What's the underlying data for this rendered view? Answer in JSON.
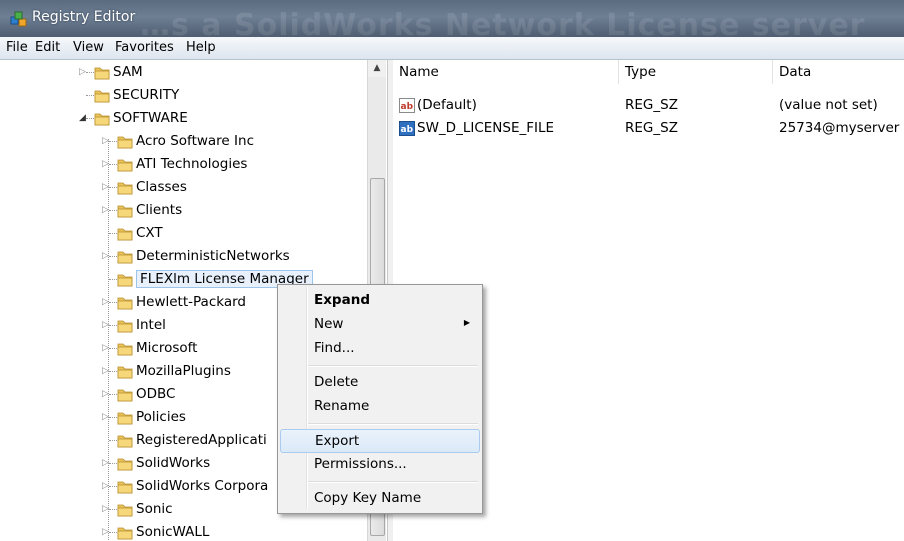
{
  "window": {
    "title": "Registry Editor",
    "background_title": "…s a SolidWorks Network License server"
  },
  "menubar": [
    "File",
    "Edit",
    "View",
    "Favorites",
    "Help"
  ],
  "tree": {
    "rows": [
      {
        "label": "SAM",
        "level": 0,
        "expander": "collapsed"
      },
      {
        "label": "SECURITY",
        "level": 0,
        "expander": "none"
      },
      {
        "label": "SOFTWARE",
        "level": 0,
        "expander": "expanded"
      },
      {
        "label": "Acro Software Inc",
        "level": 1,
        "expander": "collapsed"
      },
      {
        "label": "ATI Technologies",
        "level": 1,
        "expander": "collapsed"
      },
      {
        "label": "Classes",
        "level": 1,
        "expander": "collapsed"
      },
      {
        "label": "Clients",
        "level": 1,
        "expander": "collapsed"
      },
      {
        "label": "CXT",
        "level": 1,
        "expander": "none"
      },
      {
        "label": "DeterministicNetworks",
        "level": 1,
        "expander": "collapsed"
      },
      {
        "label": "FLEXlm License Manager",
        "level": 1,
        "expander": "none",
        "selected": true
      },
      {
        "label": "Hewlett-Packard",
        "level": 1,
        "expander": "collapsed"
      },
      {
        "label": "Intel",
        "level": 1,
        "expander": "collapsed"
      },
      {
        "label": "Microsoft",
        "level": 1,
        "expander": "collapsed"
      },
      {
        "label": "MozillaPlugins",
        "level": 1,
        "expander": "collapsed"
      },
      {
        "label": "ODBC",
        "level": 1,
        "expander": "collapsed"
      },
      {
        "label": "Policies",
        "level": 1,
        "expander": "collapsed"
      },
      {
        "label": "RegisteredApplicati",
        "level": 1,
        "expander": "none"
      },
      {
        "label": "SolidWorks",
        "level": 1,
        "expander": "collapsed"
      },
      {
        "label": "SolidWorks Corpora",
        "level": 1,
        "expander": "collapsed"
      },
      {
        "label": "Sonic",
        "level": 1,
        "expander": "collapsed"
      },
      {
        "label": "SonicWALL",
        "level": 1,
        "expander": "collapsed"
      }
    ]
  },
  "values_pane": {
    "columns": [
      "Name",
      "Type",
      "Data"
    ],
    "rows": [
      {
        "name": "(Default)",
        "type": "REG_SZ",
        "data": "(value not set)"
      },
      {
        "name": "SW_D_LICENSE_FILE",
        "type": "REG_SZ",
        "data": "25734@myserver"
      }
    ]
  },
  "context_menu": {
    "items": [
      {
        "label": "Expand",
        "bold": true
      },
      {
        "label": "New",
        "submenu": true
      },
      {
        "label": "Find..."
      },
      {
        "separator": true
      },
      {
        "label": "Delete"
      },
      {
        "label": "Rename"
      },
      {
        "separator": true
      },
      {
        "label": "Export",
        "highlighted": true
      },
      {
        "label": "Permissions..."
      },
      {
        "separator": true
      },
      {
        "label": "Copy Key Name"
      }
    ]
  },
  "icons": {
    "window": "registry-editor-icon",
    "folder": "folder-icon",
    "string_value": "reg-sz-value-icon"
  }
}
